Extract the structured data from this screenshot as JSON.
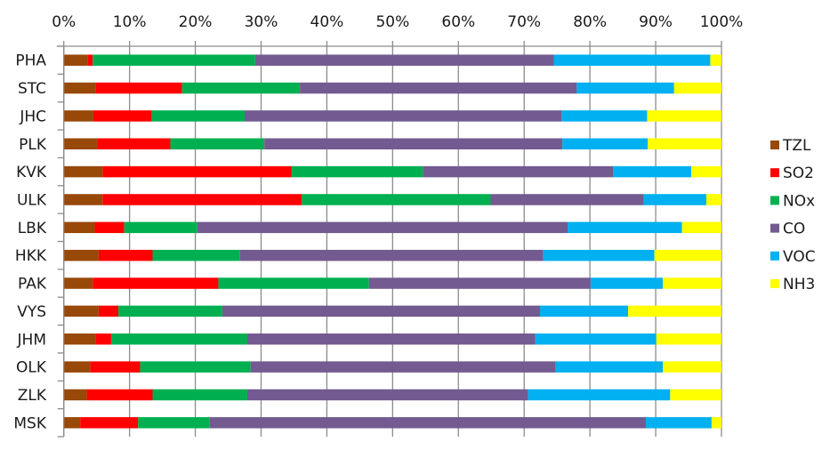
{
  "chart_data": {
    "type": "bar",
    "orientation": "horizontal",
    "stacked": "percent",
    "title": "",
    "xlabel": "",
    "ylabel": "",
    "xlim": [
      0,
      100
    ],
    "x_axis_position": "top",
    "x_ticks": [
      "0%",
      "10%",
      "20%",
      "30%",
      "40%",
      "50%",
      "60%",
      "70%",
      "80%",
      "90%",
      "100%"
    ],
    "grid": true,
    "legend_position": "right",
    "categories": [
      "PHA",
      "STC",
      "JHC",
      "PLK",
      "KVK",
      "ULK",
      "LBK",
      "HKK",
      "PAK",
      "VYS",
      "JHM",
      "OLK",
      "ZLK",
      "MSK"
    ],
    "series": [
      {
        "name": "TZL",
        "color": "#984807",
        "values": [
          3.6,
          4.8,
          4.5,
          5.1,
          5.9,
          5.9,
          4.7,
          5.3,
          4.4,
          5.3,
          4.8,
          4.0,
          3.5,
          2.5
        ]
      },
      {
        "name": "SO2",
        "color": "#FF0000",
        "values": [
          0.8,
          13.2,
          8.9,
          11.1,
          28.7,
          30.3,
          4.5,
          8.2,
          19.1,
          3.0,
          2.4,
          7.6,
          10.0,
          8.8
        ]
      },
      {
        "name": "NOx",
        "color": "#00B050",
        "values": [
          24.7,
          17.9,
          14.1,
          14.3,
          20.0,
          28.7,
          11.1,
          13.3,
          22.9,
          15.8,
          20.7,
          16.8,
          14.4,
          10.9
        ]
      },
      {
        "name": "CO",
        "color": "#735A90",
        "values": [
          45.4,
          42.1,
          48.2,
          45.3,
          28.9,
          23.3,
          56.3,
          46.1,
          33.7,
          48.3,
          43.8,
          46.4,
          42.7,
          66.3
        ]
      },
      {
        "name": "VOC",
        "color": "#00B0F0",
        "values": [
          23.8,
          14.8,
          13.0,
          13.0,
          11.9,
          9.5,
          17.4,
          16.9,
          11.0,
          13.4,
          18.4,
          16.3,
          21.6,
          10.0
        ]
      },
      {
        "name": "NH3",
        "color": "#FFFF00",
        "values": [
          1.7,
          7.2,
          11.3,
          11.2,
          4.6,
          2.3,
          6.0,
          10.2,
          8.9,
          14.2,
          9.9,
          8.9,
          7.8,
          1.5
        ]
      }
    ]
  }
}
